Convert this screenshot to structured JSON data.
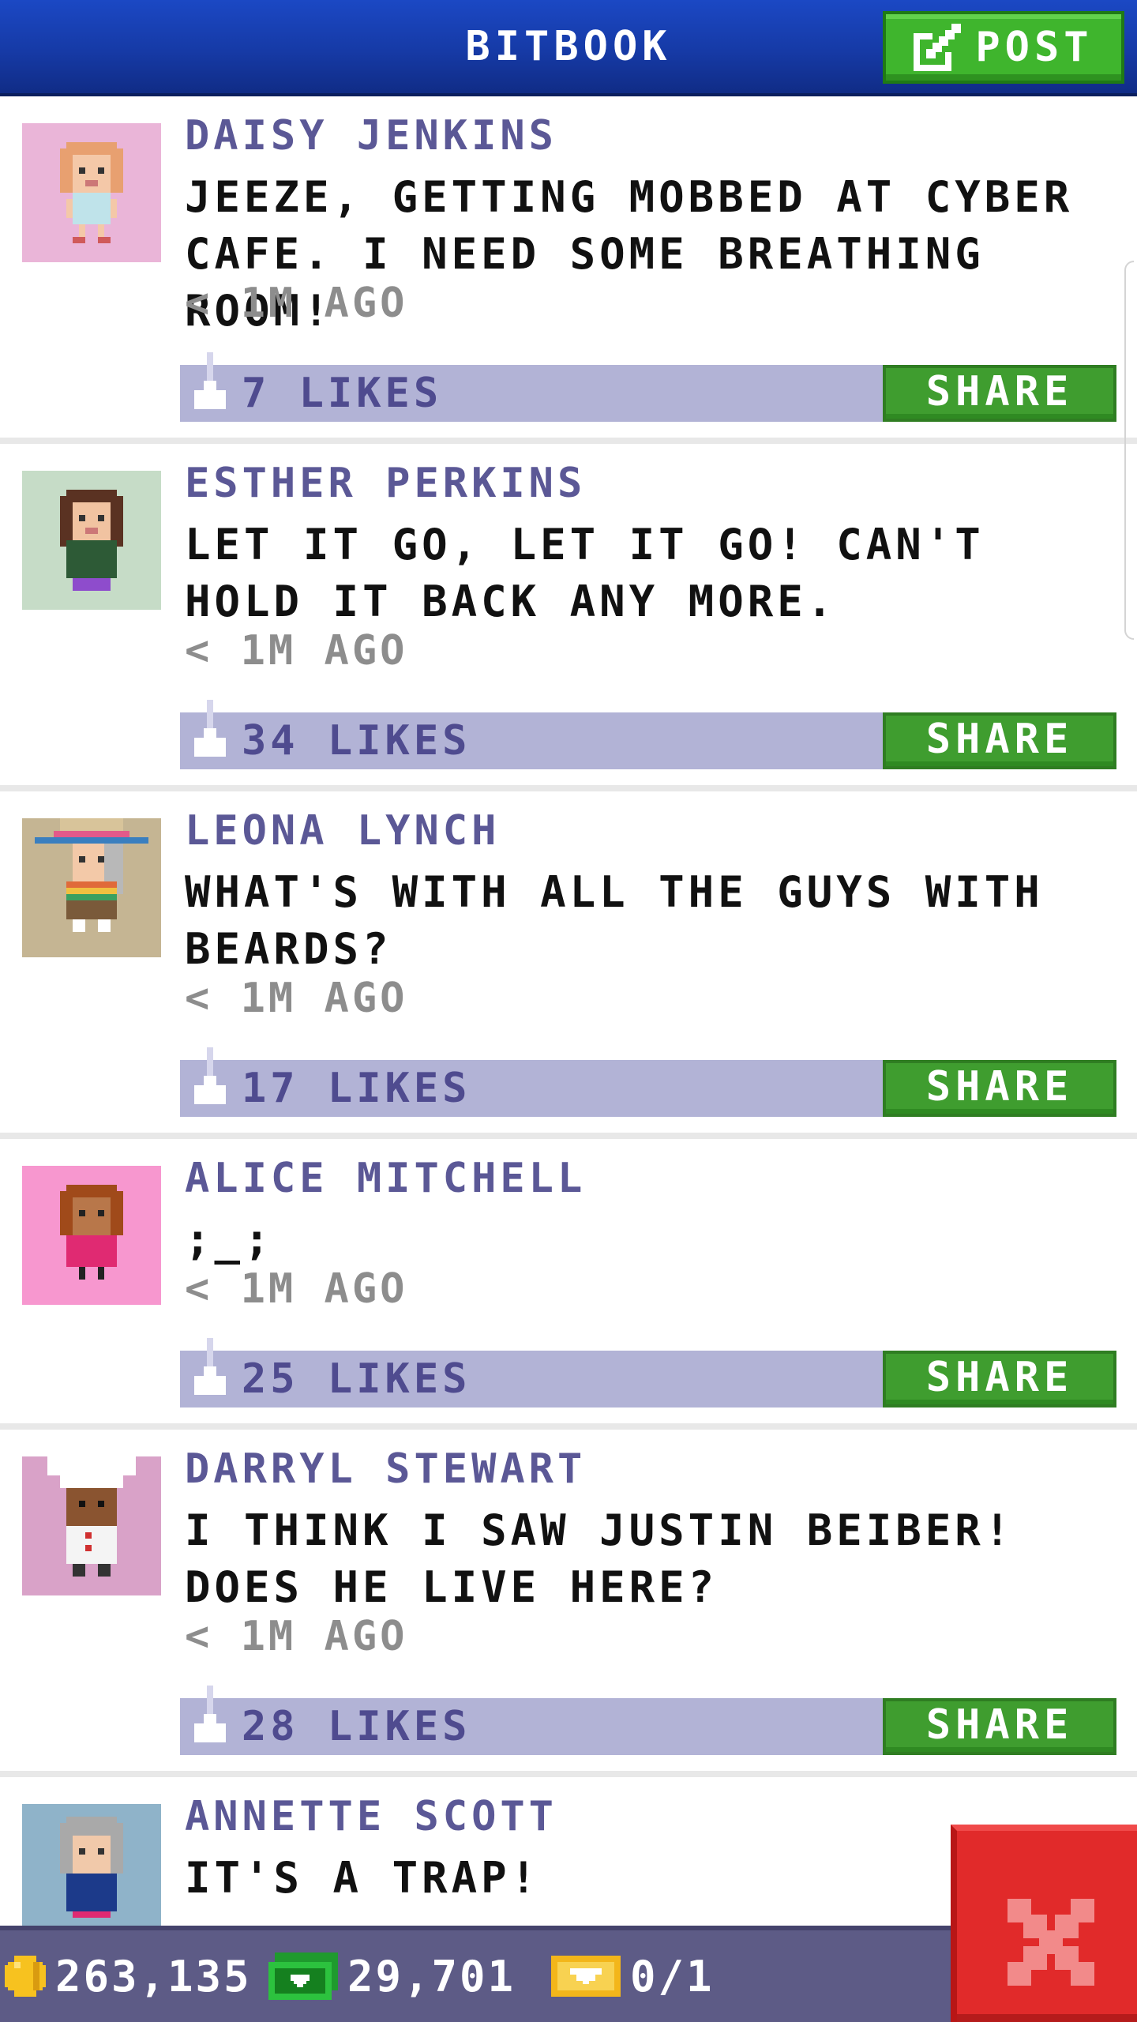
{
  "header": {
    "title": "BITBOOK",
    "post_label": "POST",
    "post_icon": "edit-icon"
  },
  "posts": [
    {
      "author": "DAISY JENKINS",
      "message": "JEEZE, GETTING MOBBED AT CYBER CAFE. I NEED SOME BREATHING ROOM!",
      "time": "< 1M AGO",
      "likes": "7 LIKES",
      "share_label": "SHARE",
      "avatar_bg": "#eab5d8"
    },
    {
      "author": "ESTHER PERKINS",
      "message": "LET IT GO, LET IT GO! CAN'T HOLD IT BACK ANY MORE.",
      "time": "< 1M AGO",
      "likes": "34 LIKES",
      "share_label": "SHARE",
      "avatar_bg": "#c6dcc7"
    },
    {
      "author": "LEONA LYNCH",
      "message": "WHAT'S WITH ALL THE GUYS WITH BEARDS?",
      "time": "< 1M AGO",
      "likes": "17 LIKES",
      "share_label": "SHARE",
      "avatar_bg": "#c5b593"
    },
    {
      "author": "ALICE MITCHELL",
      "message": ";_;",
      "time": "< 1M AGO",
      "likes": "25 LIKES",
      "share_label": "SHARE",
      "avatar_bg": "#f797cf"
    },
    {
      "author": "DARRYL STEWART",
      "message": "I THINK I SAW JUSTIN BEIBER! DOES HE LIVE HERE?",
      "time": "< 1M AGO",
      "likes": "28 LIKES",
      "share_label": "SHARE",
      "avatar_bg": "#d9a2c8"
    },
    {
      "author": "ANNETTE SCOTT",
      "message": "IT'S A TRAP!",
      "time": "",
      "likes": "",
      "share_label": "",
      "avatar_bg": "#8fb3c9"
    }
  ],
  "resources": {
    "coins": "263,135",
    "bux": "29,701",
    "tickets": "0/1"
  },
  "colors": {
    "header_blue": "#163aa6",
    "post_green": "#3fb52d",
    "author_purple": "#5b5896",
    "likes_bar": "#b2b3d6",
    "share_green": "#3f9d2f",
    "close_red": "#e12a2a",
    "resource_bar": "#5d5b86"
  }
}
